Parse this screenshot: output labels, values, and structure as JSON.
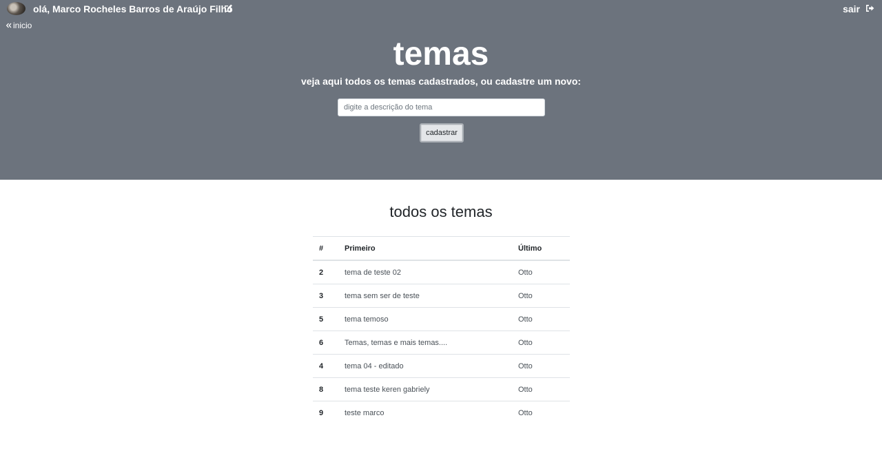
{
  "header": {
    "greeting": "olá, Marco Rocheles Barros de Araújo Filho",
    "logout_label": "sair",
    "back_label": "inicio"
  },
  "hero": {
    "title": "temas",
    "subtitle": "veja aqui todos os temas cadastrados, ou cadastre um novo:",
    "input_placeholder": "digite a descrição do tema",
    "input_value": "",
    "submit_label": "cadastrar"
  },
  "list": {
    "heading": "todos os temas",
    "columns": [
      "#",
      "Primeiro",
      "Último"
    ],
    "rows": [
      {
        "id": "2",
        "description": "tema de teste 02",
        "last": "Otto"
      },
      {
        "id": "3",
        "description": "tema sem ser de teste",
        "last": "Otto"
      },
      {
        "id": "5",
        "description": "tema temoso",
        "last": "Otto"
      },
      {
        "id": "6",
        "description": "Temas, temas e mais temas....",
        "last": "Otto"
      },
      {
        "id": "4",
        "description": "tema 04 - editado",
        "last": "Otto"
      },
      {
        "id": "8",
        "description": "tema teste keren gabriely",
        "last": "Otto"
      },
      {
        "id": "9",
        "description": "teste marco",
        "last": "Otto"
      }
    ]
  },
  "icons": {
    "edit": "edit-icon",
    "logout": "sign-out-icon",
    "back": "double-chevron-left-icon"
  },
  "colors": {
    "hero_background": "#6c737d",
    "hero_text": "#ffffff",
    "table_border": "#dee2e6"
  }
}
